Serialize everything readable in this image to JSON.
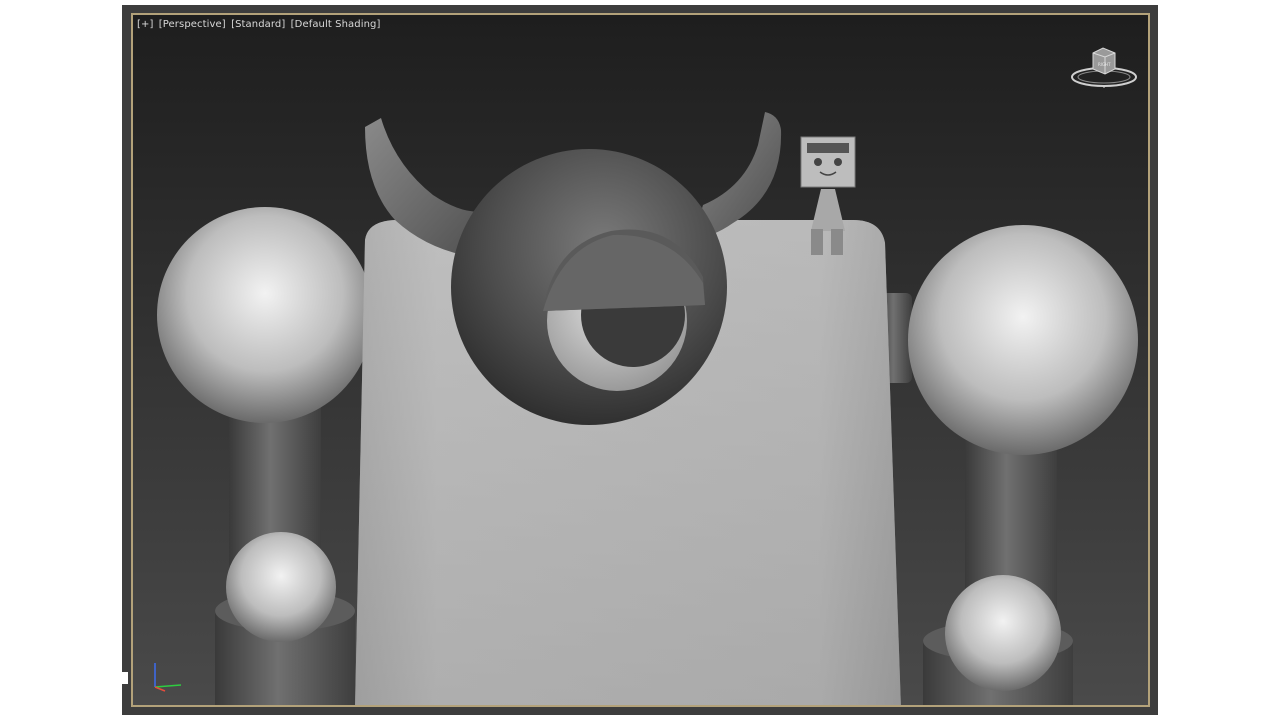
{
  "viewport": {
    "menu_plus": "[+]",
    "view_label": "[Perspective]",
    "style_label": "[Standard]",
    "shading_label": "[Default Shading]",
    "border_color": "#b3a27a"
  },
  "viewcube": {
    "face_label": "RIGHT"
  },
  "axis_gizmo": {
    "x_color": "#2ecc40",
    "y_color": "#e74c3c",
    "z_color": "#3c6cf0"
  },
  "icons": [
    "viewcube-icon",
    "axis-tripod-icon"
  ]
}
